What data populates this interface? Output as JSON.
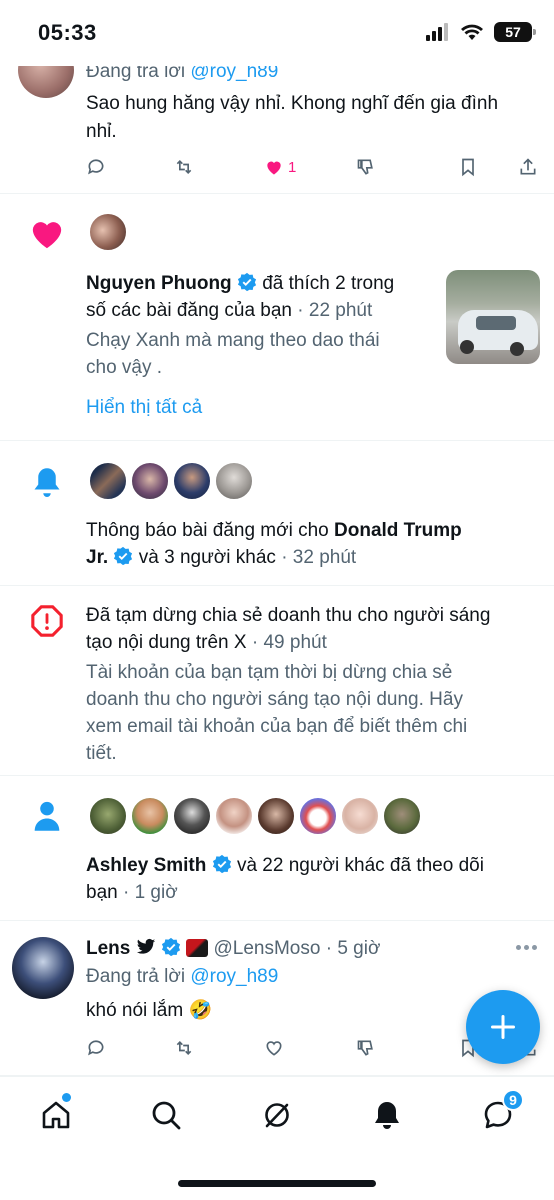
{
  "status_bar": {
    "time": "05:33",
    "battery": "57"
  },
  "reply_item": {
    "replying_prefix": "Đang trả lời",
    "replying_handle": "@roy_h89",
    "text_line1": "Sao hung hăng vậy nhỉ. Khong nghĩ đến gia đình",
    "text_line2": "nhỉ.",
    "like_count": "1"
  },
  "like_notification": {
    "name": "Nguyen Phuong",
    "action_line1": "đã thích 2 trong",
    "action_line2": "số các bài đăng của bạn",
    "time": "· 22 phút",
    "preview_line1": "Chạy Xanh mà mang theo dao thái",
    "preview_line2": "cho vậy  .",
    "show_all": "Hiển thị tất cả"
  },
  "post_notification": {
    "text_prefix": "Thông báo bài đăng mới cho",
    "name_line1": "Donald Trump",
    "name_line2": "Jr.",
    "others": "và 3 người khác",
    "time": "· 32 phút"
  },
  "alert_notification": {
    "title_line1": "Đã tạm dừng chia sẻ doanh thu cho người sáng",
    "title_line2": "tạo nội dung trên X",
    "time": "· 49 phút",
    "body_line1": "Tài khoản của bạn tạm thời bị dừng chia sẻ",
    "body_line2": "doanh thu cho người sáng tạo nội dung. Hãy",
    "body_line3": "xem email tài khoản của bạn để biết thêm chi",
    "body_line4": "tiết."
  },
  "follow_notification": {
    "name": "Ashley Smith",
    "others_line1": "và 22 người khác đã theo dõi",
    "others_line2": "bạn",
    "time": "· 1 giờ"
  },
  "lens_reply": {
    "name": "Lens",
    "handle": "@LensMoso",
    "time": "· 5 giờ",
    "replying_prefix": "Đang trả lời",
    "replying_handle": "@roy_h89",
    "text": "khó nói lắm 🤣"
  },
  "bottom_nav": {
    "messages_badge": "9"
  },
  "colors": {
    "accent": "#1d9bf0",
    "like": "#f91880",
    "alert": "#f4212e",
    "text": "#0f1419",
    "muted": "#536471"
  }
}
